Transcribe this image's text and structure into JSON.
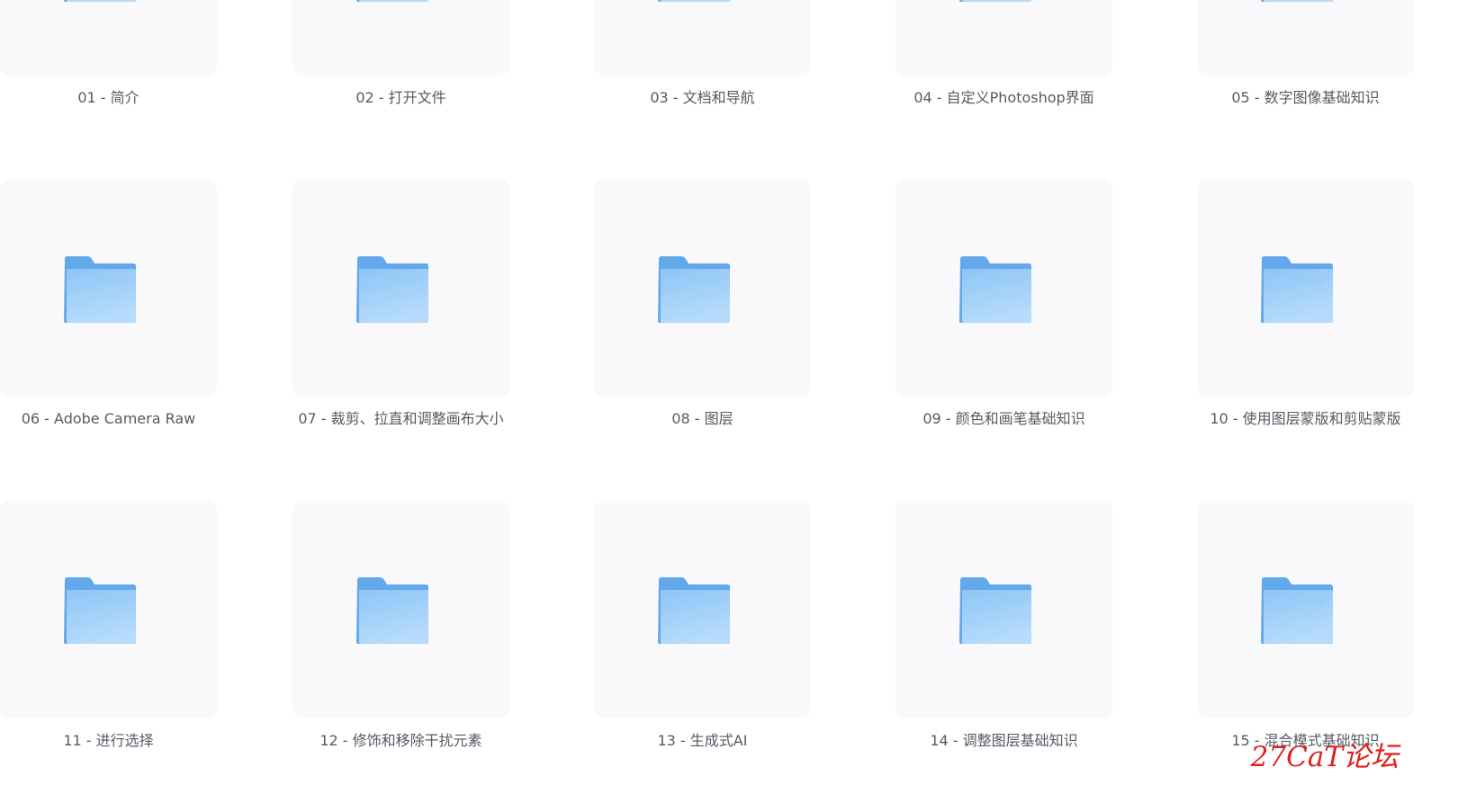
{
  "folders": [
    {
      "name": "01 - 简介"
    },
    {
      "name": "02 - 打开文件"
    },
    {
      "name": "03 - 文档和导航"
    },
    {
      "name": "04 - 自定义Photoshop界面"
    },
    {
      "name": "05 - 数字图像基础知识"
    },
    {
      "name": "06 - Adobe Camera Raw"
    },
    {
      "name": "07 - 裁剪、拉直和调整画布大小"
    },
    {
      "name": "08 - 图层"
    },
    {
      "name": "09 - 颜色和画笔基础知识"
    },
    {
      "name": "10 - 使用图层蒙版和剪贴蒙版"
    },
    {
      "name": "11 - 进行选择"
    },
    {
      "name": "12 - 修饰和移除干扰元素"
    },
    {
      "name": "13 - 生成式AI"
    },
    {
      "name": "14 - 调整图层基础知识"
    },
    {
      "name": "15 - 混合模式基础知识"
    }
  ],
  "icon": "folder-icon",
  "colors": {
    "tile_background": "#f9f9fb",
    "folder_back": "#62a8eb",
    "folder_front_top": "#8dc5f6",
    "folder_front_bottom": "#b6dbfb",
    "label_text": "#555a64",
    "watermark": "#e02020"
  },
  "watermark": "27CaT论坛"
}
